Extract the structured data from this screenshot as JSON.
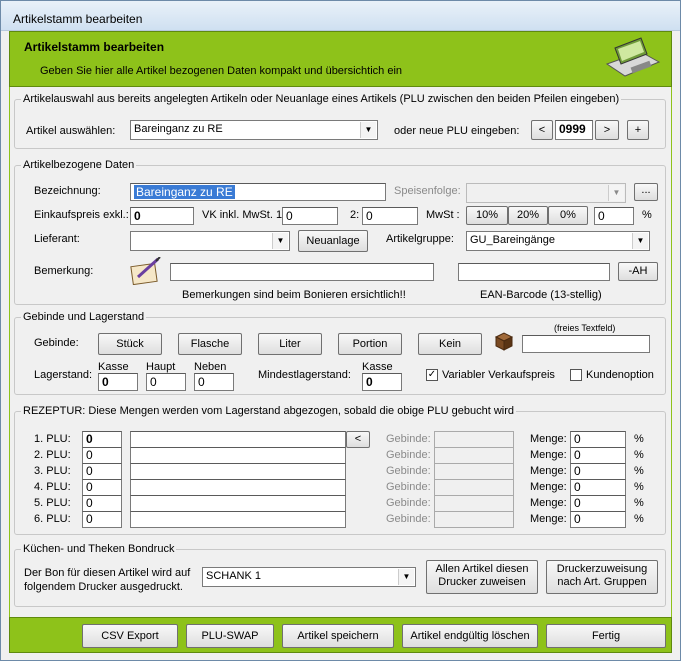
{
  "window": {
    "title": "Artikelstamm bearbeiten"
  },
  "banner": {
    "title": "Artikelstamm bearbeiten",
    "subtitle": "Geben Sie hier alle Artikel bezogenen Daten kompakt und übersichtich ein"
  },
  "auswahl": {
    "legend": "Artikelauswahl aus bereits angelegten Artikeln oder Neuanlage eines Artikels (PLU zwischen den beiden Pfeilen eingeben)",
    "artikel_label": "Artikel auswählen:",
    "artikel_value": "Bareinganz zu RE",
    "plu_label": "oder neue PLU eingeben:",
    "prev": "<",
    "plu_value": "0999",
    "next": ">",
    "plus": "+"
  },
  "artikel": {
    "legend": "Artikelbezogene Daten",
    "bezeichnung_label": "Bezeichnung:",
    "bezeichnung_value": "Bareinganz zu RE",
    "speisenfolge_label": "Speisenfolge:",
    "speisenfolge_value": "",
    "dots": "...",
    "ek_label": "Einkaufspreis exkl.:",
    "ek_value": "0",
    "vk_label": "VK inkl. MwSt. 1:",
    "vk_value": "0",
    "vk2_label": "2:",
    "vk2_value": "0",
    "mwst_label": "MwSt :",
    "mwst_options": [
      "10%",
      "20%",
      "0%"
    ],
    "mwst_value": "0",
    "pct": "%",
    "lieferant_label": "Lieferant:",
    "lieferant_value": "",
    "neuanlage": "Neuanlage",
    "gruppe_label": "Artikelgruppe:",
    "gruppe_value": "GU_Bareingänge",
    "bemerkung_label": "Bemerkung:",
    "bemerkung_value": "",
    "ean_value": "",
    "ah": "-AH",
    "bemerkung_hint": "Bemerkungen sind beim Bonieren ersichtlich!!",
    "ean_hint": "EAN-Barcode (13-stellig)"
  },
  "gebinde": {
    "legend": "Gebinde und Lagerstand",
    "label": "Gebinde:",
    "buttons": [
      "Stück",
      "Flasche",
      "Liter",
      "Portion",
      "Kein"
    ],
    "freitext_label": "(freies Textfeld)",
    "freitext_value": "",
    "lagerstand_label": "Lagerstand:",
    "kasse_label": "Kasse",
    "kasse_value": "0",
    "haupt_label": "Haupt",
    "haupt_value": "0",
    "neben_label": "Neben",
    "neben_value": "0",
    "mindest_label": "Mindestlagerstand:",
    "mindest_kasse_label": "Kasse",
    "mindest_value": "0",
    "variabler_label": "Variabler Verkaufspreis",
    "variabler_checked": true,
    "kundenoption_label": "Kundenoption",
    "kundenoption_checked": false
  },
  "rezeptur": {
    "legend": "REZEPTUR: Diese Mengen werden vom Lagerstand abgezogen, sobald die obige PLU gebucht wird",
    "back": "<",
    "gebinde_label": "Gebinde:",
    "menge_label": "Menge:",
    "pct": "%",
    "rows": [
      {
        "label": "1. PLU:",
        "plu": "0",
        "menge": "0"
      },
      {
        "label": "2. PLU:",
        "plu": "0",
        "menge": "0"
      },
      {
        "label": "3. PLU:",
        "plu": "0",
        "menge": "0"
      },
      {
        "label": "4. PLU:",
        "plu": "0",
        "menge": "0"
      },
      {
        "label": "5. PLU:",
        "plu": "0",
        "menge": "0"
      },
      {
        "label": "6. PLU:",
        "plu": "0",
        "menge": "0"
      }
    ]
  },
  "bondruck": {
    "legend": "Küchen- und Theken Bondruck",
    "text1": "Der Bon für diesen Artikel wird auf",
    "text2": "folgendem Drucker ausgedruckt.",
    "drucker_value": "SCHANK 1",
    "allen1": "Allen Artikel diesen",
    "allen2": "Drucker zuweisen",
    "zuw1": "Druckerzuweisung",
    "zuw2": "nach Art. Gruppen"
  },
  "footer": {
    "csv": "CSV Export",
    "swap": "PLU-SWAP",
    "save": "Artikel speichern",
    "delete": "Artikel endgültig löschen",
    "done": "Fertig"
  },
  "colors": {
    "banner": "#8ec21a",
    "selection": "#3a7bd5"
  }
}
